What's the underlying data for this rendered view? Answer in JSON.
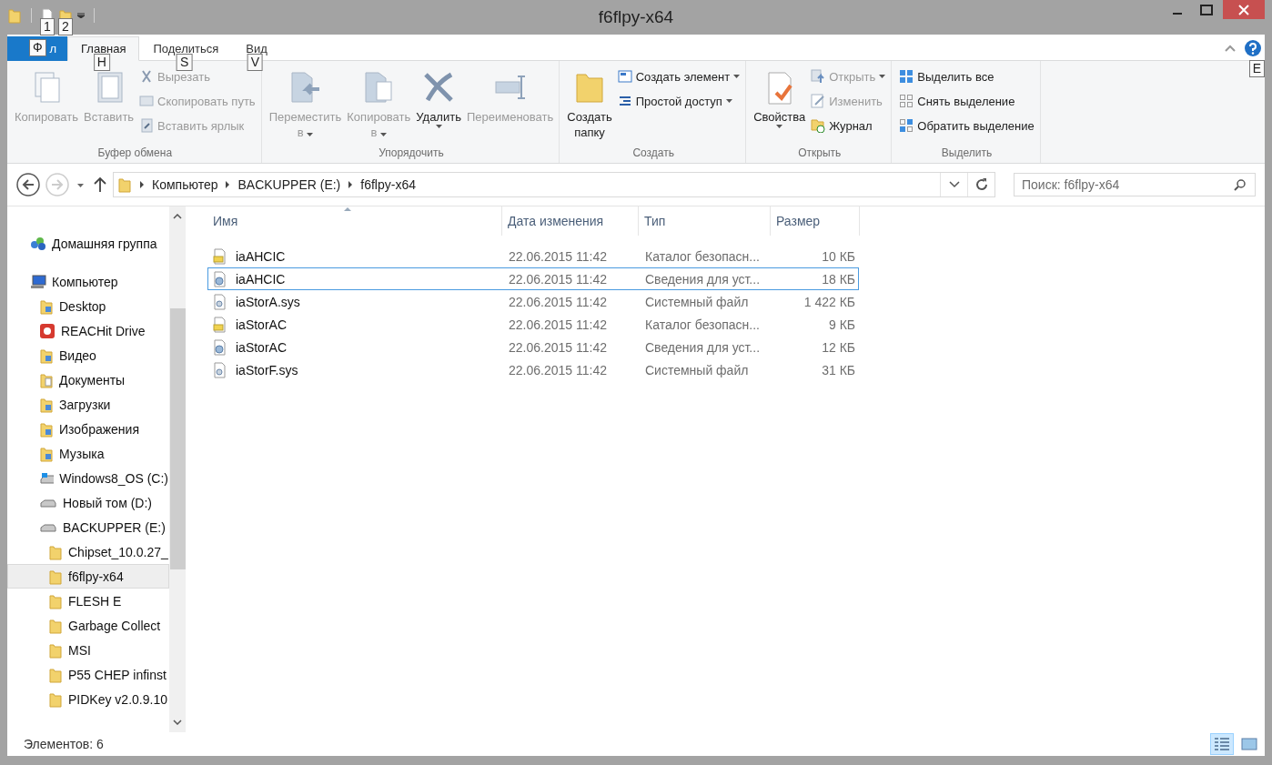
{
  "window": {
    "title": "f6flpy-x64"
  },
  "quick_access": {
    "keytips": [
      "1",
      "2"
    ]
  },
  "ribbon_tabs": [
    {
      "kind": "file",
      "label": "л",
      "keytip": "Ф",
      "selected": false
    },
    {
      "kind": "tab",
      "label": "Главная",
      "keytip": "H",
      "selected": true
    },
    {
      "kind": "tab",
      "label": "Поделиться",
      "keytip": "S",
      "selected": false
    },
    {
      "kind": "tab",
      "label": "Вид",
      "keytip": "V",
      "selected": false
    }
  ],
  "help_keytip": "E",
  "ribbon_groups": [
    {
      "title": "Буфер обмена",
      "items": [
        {
          "kind": "large",
          "lines": [
            "Копировать"
          ],
          "disabled": true,
          "dropdown": false
        },
        {
          "kind": "large",
          "lines": [
            "Вставить"
          ],
          "disabled": true,
          "dropdown": false
        },
        {
          "kind": "small",
          "lines": [
            "Вырезать"
          ],
          "disabled": true,
          "dropdown": false
        },
        {
          "kind": "small",
          "lines": [
            "Скопировать путь"
          ],
          "disabled": true,
          "dropdown": false
        },
        {
          "kind": "small",
          "lines": [
            "Вставить ярлык"
          ],
          "disabled": true,
          "dropdown": false
        }
      ]
    },
    {
      "title": "Упорядочить",
      "items": [
        {
          "kind": "large",
          "lines": [
            "Переместить",
            "в"
          ],
          "disabled": true,
          "dropdown": true
        },
        {
          "kind": "large",
          "lines": [
            "Копировать",
            "в"
          ],
          "disabled": true,
          "dropdown": true
        },
        {
          "kind": "large",
          "lines": [
            "Удалить"
          ],
          "disabled": false,
          "dropdown": true
        },
        {
          "kind": "large",
          "lines": [
            "Переименовать"
          ],
          "disabled": true,
          "dropdown": false
        }
      ]
    },
    {
      "title": "Создать",
      "items": [
        {
          "kind": "large",
          "lines": [
            "Создать",
            "папку"
          ],
          "disabled": false,
          "dropdown": false
        },
        {
          "kind": "small",
          "lines": [
            "Создать элемент"
          ],
          "disabled": false,
          "dropdown": true
        },
        {
          "kind": "small",
          "lines": [
            "Простой доступ"
          ],
          "disabled": false,
          "dropdown": true
        }
      ]
    },
    {
      "title": "Открыть",
      "items": [
        {
          "kind": "large",
          "lines": [
            "Свойства"
          ],
          "disabled": false,
          "dropdown": true
        },
        {
          "kind": "small",
          "lines": [
            "Открыть"
          ],
          "disabled": true,
          "dropdown": true
        },
        {
          "kind": "small",
          "lines": [
            "Изменить"
          ],
          "disabled": true,
          "dropdown": false
        },
        {
          "kind": "small",
          "lines": [
            "Журнал"
          ],
          "disabled": false,
          "dropdown": false
        }
      ]
    },
    {
      "title": "Выделить",
      "items": [
        {
          "kind": "small",
          "lines": [
            "Выделить все"
          ],
          "disabled": false,
          "dropdown": false
        },
        {
          "kind": "small",
          "lines": [
            "Снять выделение"
          ],
          "disabled": false,
          "dropdown": false
        },
        {
          "kind": "small",
          "lines": [
            "Обратить выделение"
          ],
          "disabled": false,
          "dropdown": false
        }
      ]
    }
  ],
  "address_bar": {
    "crumbs": [
      "Компьютер",
      "BACKUPPER (E:)",
      "f6flpy-x64"
    ]
  },
  "search": {
    "placeholder": "Поиск: f6flpy-x64"
  },
  "nav_tree": [
    {
      "label": "Домашняя группа",
      "kind": "homegroup",
      "selected": false
    },
    {
      "label": "Компьютер",
      "kind": "computer",
      "selected": false,
      "children": [
        {
          "label": "Desktop",
          "kind": "library",
          "selected": false
        },
        {
          "label": "REACHit Drive",
          "kind": "app",
          "selected": false
        },
        {
          "label": "Видео",
          "kind": "library",
          "selected": false
        },
        {
          "label": "Документы",
          "kind": "documents",
          "selected": false
        },
        {
          "label": "Загрузки",
          "kind": "library",
          "selected": false
        },
        {
          "label": "Изображения",
          "kind": "library",
          "selected": false
        },
        {
          "label": "Музыка",
          "kind": "library",
          "selected": false
        },
        {
          "label": "Windows8_OS (C:)",
          "kind": "systemdrive",
          "selected": false
        },
        {
          "label": "Новый том (D:)",
          "kind": "drive",
          "selected": false
        },
        {
          "label": "BACKUPPER (E:)",
          "kind": "drive",
          "selected": false,
          "children": [
            {
              "label": "Chipset_10.0.27_",
              "kind": "folder",
              "selected": false
            },
            {
              "label": "f6flpy-x64",
              "kind": "folder",
              "selected": true
            },
            {
              "label": "FLESH E",
              "kind": "folder",
              "selected": false
            },
            {
              "label": "Garbage Collect",
              "kind": "folder",
              "selected": false
            },
            {
              "label": "MSI",
              "kind": "folder",
              "selected": false
            },
            {
              "label": "P55 CHEP infinst",
              "kind": "folder",
              "selected": false
            },
            {
              "label": "PIDKey v2.0.9.10",
              "kind": "folder",
              "selected": false
            }
          ]
        }
      ]
    }
  ],
  "file_list": {
    "columns": [
      "Имя",
      "Дата изменения",
      "Тип",
      "Размер"
    ],
    "rows": [
      {
        "kind": "catalog",
        "name": "iaAHCIC",
        "date": "22.06.2015 11:42",
        "type": "Каталог безопасн...",
        "size": "10 КБ",
        "selected": false
      },
      {
        "kind": "inf",
        "name": "iaAHCIC",
        "date": "22.06.2015 11:42",
        "type": "Сведения для уст...",
        "size": "18 КБ",
        "selected": true
      },
      {
        "kind": "sys",
        "name": "iaStorA.sys",
        "date": "22.06.2015 11:42",
        "type": "Системный файл",
        "size": "1 422 КБ",
        "selected": false
      },
      {
        "kind": "catalog",
        "name": "iaStorAC",
        "date": "22.06.2015 11:42",
        "type": "Каталог безопасн...",
        "size": "9 КБ",
        "selected": false
      },
      {
        "kind": "inf",
        "name": "iaStorAC",
        "date": "22.06.2015 11:42",
        "type": "Сведения для уст...",
        "size": "12 КБ",
        "selected": false
      },
      {
        "kind": "sys",
        "name": "iaStorF.sys",
        "date": "22.06.2015 11:42",
        "type": "Системный файл",
        "size": "31 КБ",
        "selected": false
      }
    ]
  },
  "status_bar": {
    "count": "Элементов: 6",
    "views": [
      {
        "kind": "details",
        "selected": true
      },
      {
        "kind": "tiles",
        "selected": false
      }
    ]
  }
}
